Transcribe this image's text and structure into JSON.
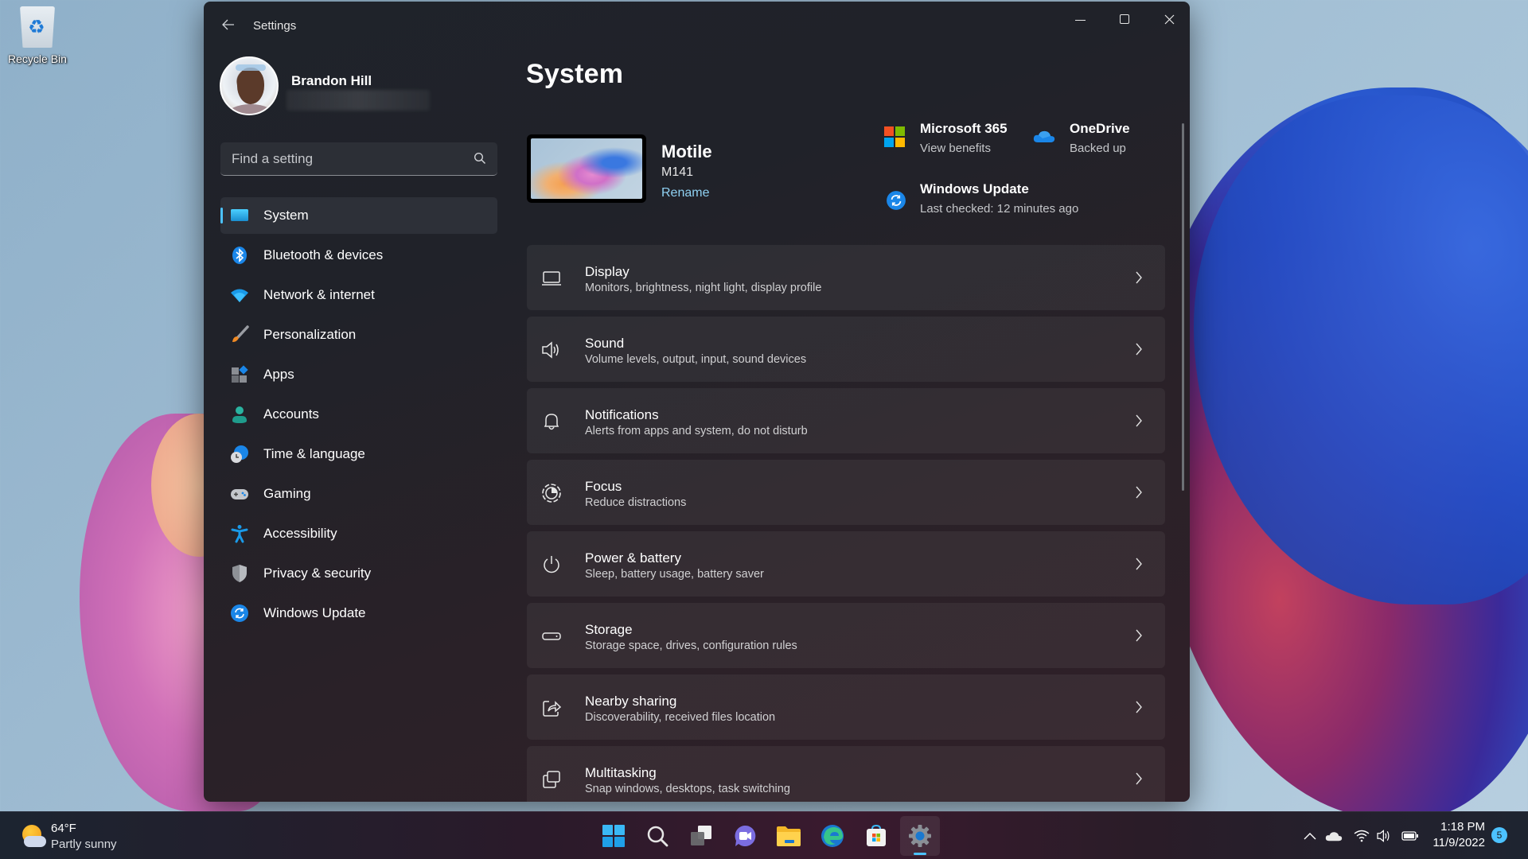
{
  "desktop": {
    "icons": [
      {
        "label": "Recycle Bin",
        "icon": "recycle-bin-icon"
      }
    ]
  },
  "window": {
    "title": "Settings",
    "controls": {
      "minimize": "minimize",
      "maximize": "maximize",
      "close": "close"
    }
  },
  "profile": {
    "name": "Brandon Hill",
    "email": ""
  },
  "search": {
    "placeholder": "Find a setting",
    "value": ""
  },
  "sidebar": {
    "items": [
      {
        "label": "System",
        "icon": "system-display-icon",
        "active": true
      },
      {
        "label": "Bluetooth & devices",
        "icon": "bluetooth-icon",
        "active": false
      },
      {
        "label": "Network & internet",
        "icon": "wifi-icon",
        "active": false
      },
      {
        "label": "Personalization",
        "icon": "paintbrush-icon",
        "active": false
      },
      {
        "label": "Apps",
        "icon": "apps-icon",
        "active": false
      },
      {
        "label": "Accounts",
        "icon": "person-icon",
        "active": false
      },
      {
        "label": "Time & language",
        "icon": "globe-clock-icon",
        "active": false
      },
      {
        "label": "Gaming",
        "icon": "gamepad-icon",
        "active": false
      },
      {
        "label": "Accessibility",
        "icon": "accessibility-icon",
        "active": false
      },
      {
        "label": "Privacy & security",
        "icon": "shield-icon",
        "active": false
      },
      {
        "label": "Windows Update",
        "icon": "update-icon",
        "active": false
      }
    ]
  },
  "main": {
    "title": "System",
    "device": {
      "name": "Motile",
      "model": "M141",
      "rename_label": "Rename"
    },
    "quick_links": [
      {
        "title": "Microsoft 365",
        "subtitle": "View benefits",
        "icon": "microsoft-logo-icon"
      },
      {
        "title": "OneDrive",
        "subtitle": "Backed up",
        "icon": "onedrive-cloud-icon"
      },
      {
        "title": "Windows Update",
        "subtitle": "Last checked: 12 minutes ago",
        "icon": "update-icon"
      }
    ],
    "cards": [
      {
        "title": "Display",
        "subtitle": "Monitors, brightness, night light, display profile",
        "icon": "display-icon"
      },
      {
        "title": "Sound",
        "subtitle": "Volume levels, output, input, sound devices",
        "icon": "speaker-icon"
      },
      {
        "title": "Notifications",
        "subtitle": "Alerts from apps and system, do not disturb",
        "icon": "bell-icon"
      },
      {
        "title": "Focus",
        "subtitle": "Reduce distractions",
        "icon": "focus-icon"
      },
      {
        "title": "Power & battery",
        "subtitle": "Sleep, battery usage, battery saver",
        "icon": "power-icon"
      },
      {
        "title": "Storage",
        "subtitle": "Storage space, drives, configuration rules",
        "icon": "storage-drive-icon"
      },
      {
        "title": "Nearby sharing",
        "subtitle": "Discoverability, received files location",
        "icon": "share-icon"
      },
      {
        "title": "Multitasking",
        "subtitle": "Snap windows, desktops, task switching",
        "icon": "multitasking-icon"
      }
    ]
  },
  "taskbar": {
    "weather": {
      "temp": "64°F",
      "condition": "Partly sunny"
    },
    "apps": [
      {
        "name": "Start",
        "icon": "windows-start-icon",
        "active": false
      },
      {
        "name": "Search",
        "icon": "search-icon",
        "active": false
      },
      {
        "name": "Task View",
        "icon": "task-view-icon",
        "active": false
      },
      {
        "name": "Chat",
        "icon": "teams-chat-icon",
        "active": false
      },
      {
        "name": "File Explorer",
        "icon": "folder-icon",
        "active": false
      },
      {
        "name": "Microsoft Edge",
        "icon": "edge-icon",
        "active": false
      },
      {
        "name": "Microsoft Store",
        "icon": "store-icon",
        "active": false
      },
      {
        "name": "Settings",
        "icon": "settings-gear-icon",
        "active": true
      }
    ],
    "tray": {
      "icons": [
        "chevron-up-icon",
        "onedrive-cloud-icon",
        "wifi-icon",
        "volume-icon",
        "battery-icon"
      ],
      "time": "1:18 PM",
      "date": "11/9/2022",
      "notification_count": "5"
    }
  },
  "colors": {
    "accent": "#4cc2ff",
    "link": "#8fd1f2"
  }
}
